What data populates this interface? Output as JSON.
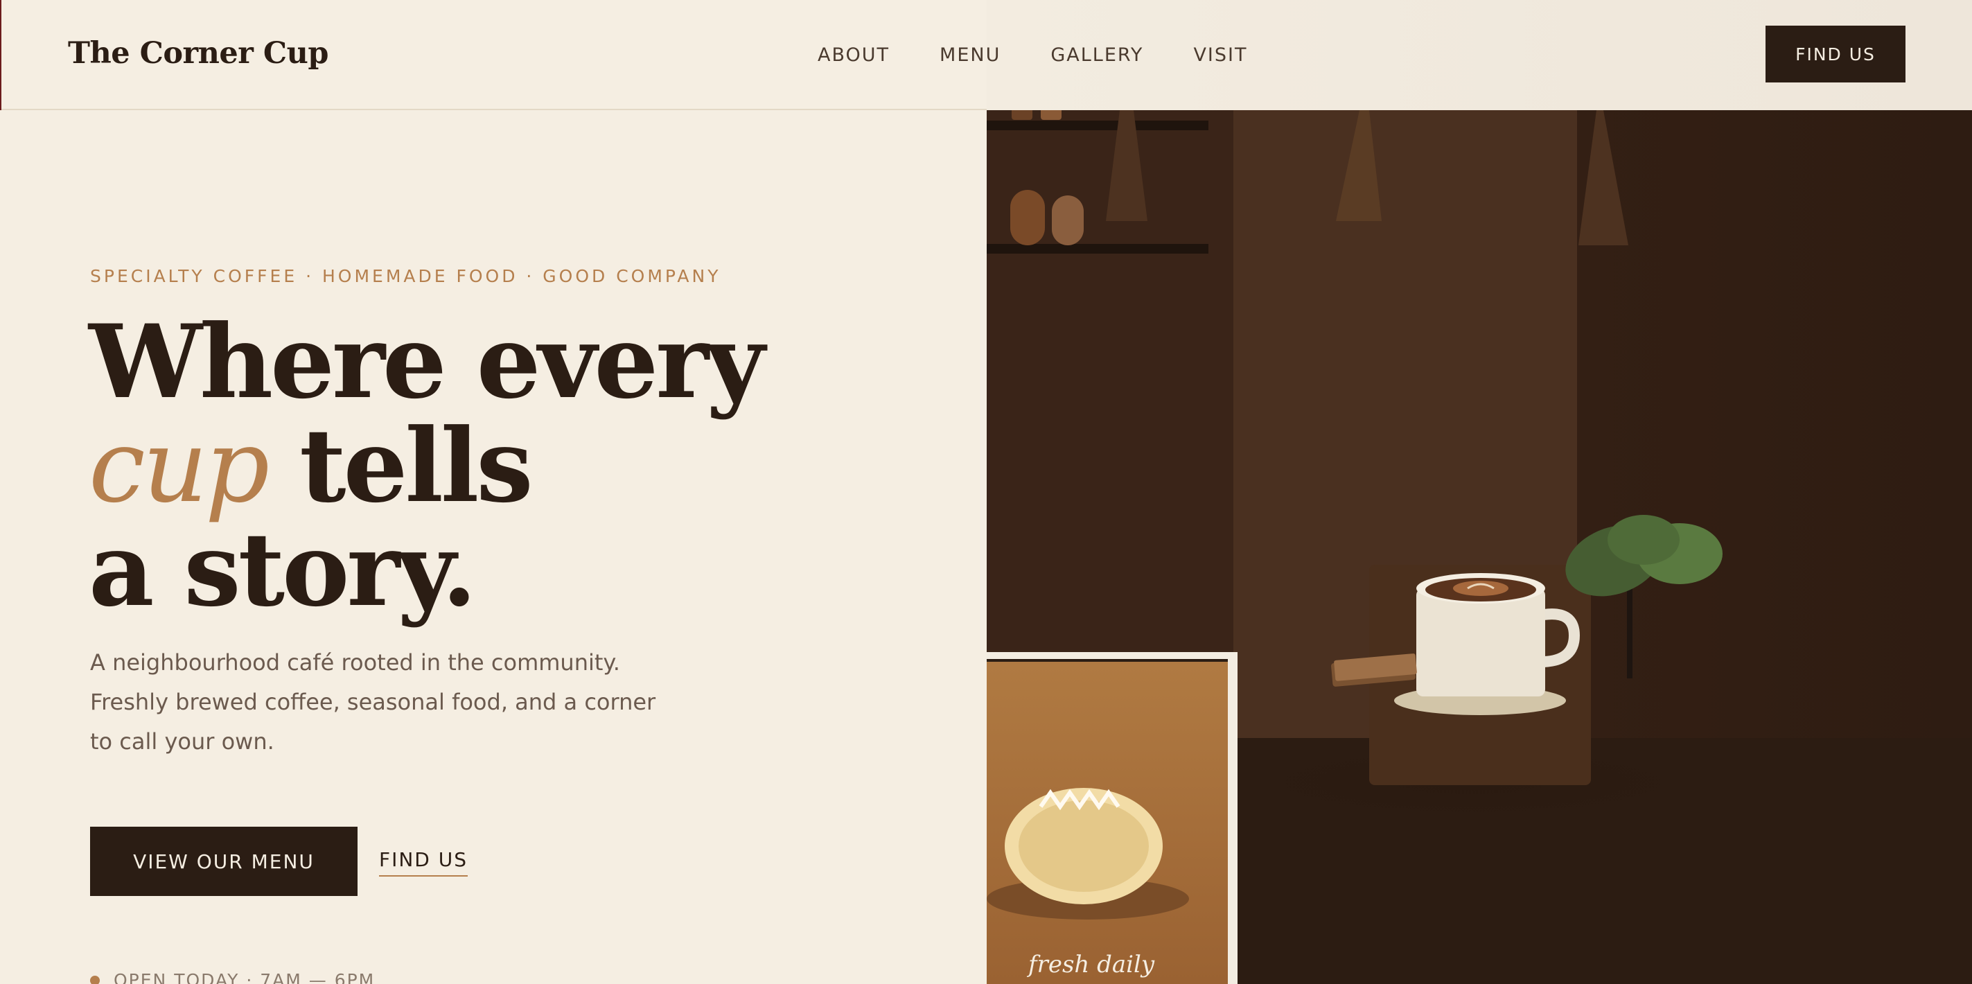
{
  "nav": {
    "brand": "The Corner Cup",
    "links": [
      "ABOUT",
      "MENU",
      "GALLERY",
      "VISIT"
    ],
    "cta": "FIND US"
  },
  "hero": {
    "kicker": "SPECIALTY COFFEE · HOMEMADE FOOD · GOOD COMPANY",
    "headline_line1": "Where every",
    "headline_accent": "cup",
    "headline_line2_rest": " tells",
    "headline_line3": "a story.",
    "lede": "A neighbourhood café rooted in the community. Freshly brewed coffee, seasonal food, and a corner to call your own.",
    "primary_button": "VIEW OUR MENU",
    "secondary_link": "FIND US",
    "hours": "OPEN TODAY · 7AM — 6PM"
  },
  "media": {
    "card_caption": "fresh daily",
    "colors": {
      "dark_wall": "#3a2518",
      "card": "#a8703a",
      "plant": "#4d6b3a"
    }
  }
}
